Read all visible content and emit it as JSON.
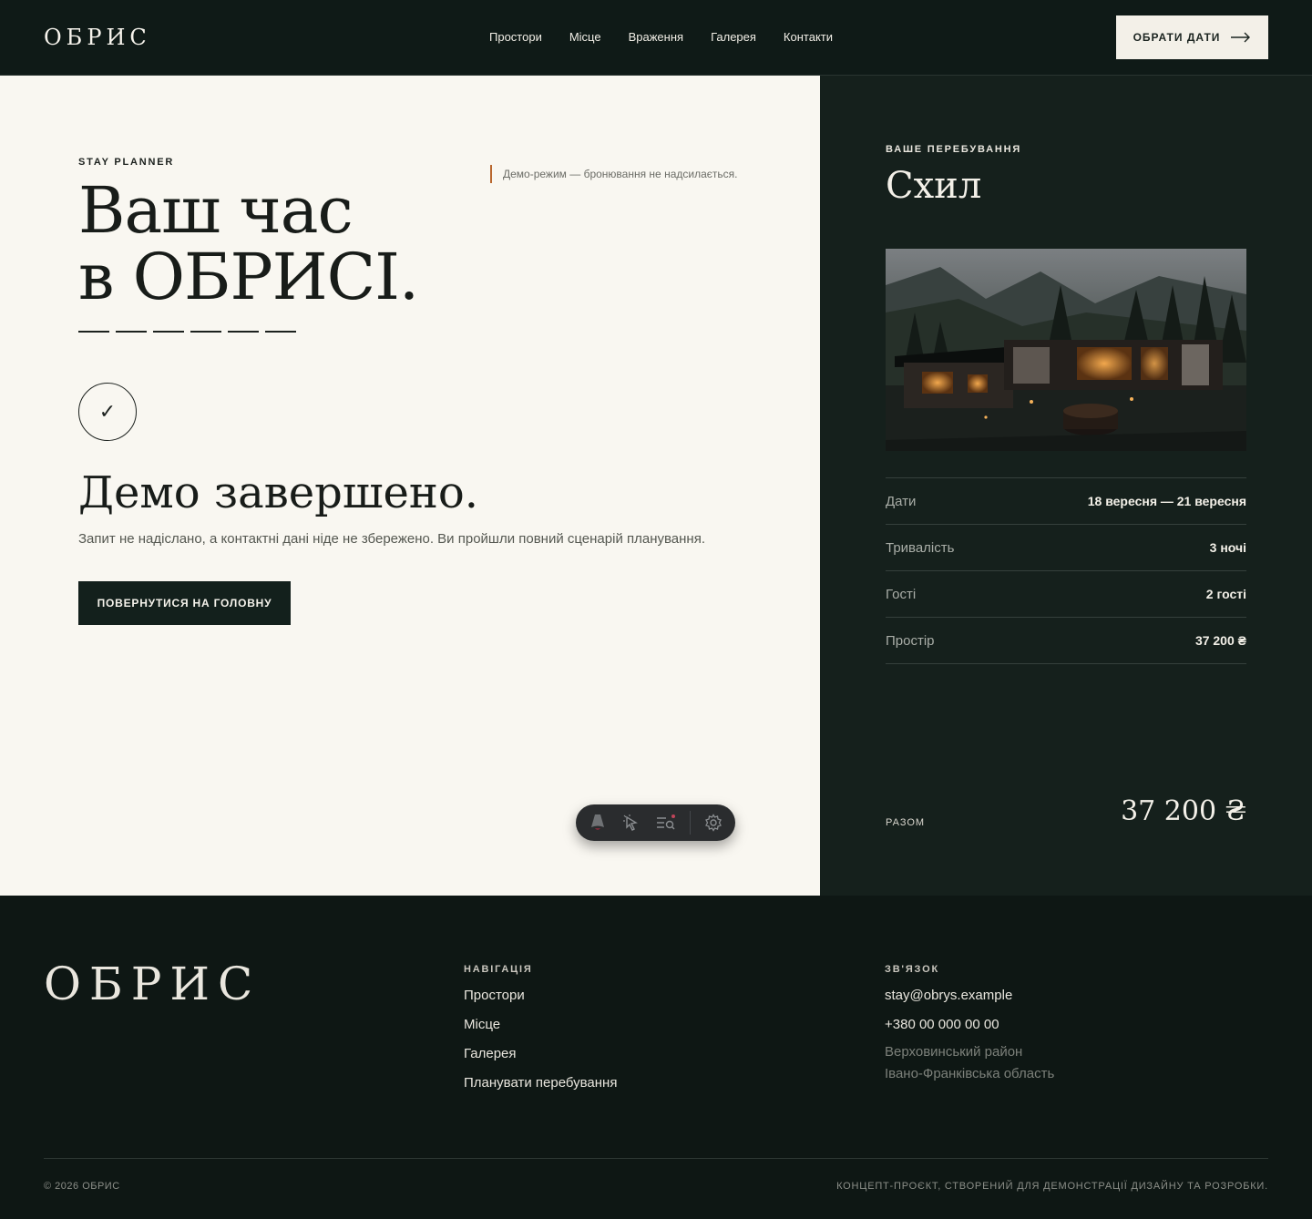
{
  "header": {
    "logo": "ОБРИС",
    "nav": [
      "Простори",
      "Місце",
      "Враження",
      "Галерея",
      "Контакти"
    ],
    "cta_label": "ОБРАТИ ДАТИ"
  },
  "planner": {
    "eyebrow": "STAY PLANNER",
    "demo_note": "Демо-режим — бронювання не надсилається.",
    "title_line1": "Ваш час",
    "title_line2": "в ОБРИСІ.",
    "step_count": 6,
    "check_symbol": "✓",
    "done_title": "Демо завершено.",
    "done_text": "Запит не надіслано, а контактні дані ніде не збережено. Ви пройшли повний сценарій планування.",
    "back_button": "ПОВЕРНУТИСЯ НА ГОЛОВНУ"
  },
  "toolbar": {
    "icons": [
      "astro-icon",
      "cursor-select-icon",
      "search-list-icon",
      "settings-gear-icon"
    ]
  },
  "summary": {
    "label": "ВАШЕ ПЕРЕБУВАННЯ",
    "name": "Схил",
    "rows": [
      {
        "key": "Дати",
        "value": "18 вересня — 21 вересня"
      },
      {
        "key": "Тривалість",
        "value": "3 ночі"
      },
      {
        "key": "Гості",
        "value": "2 гості"
      },
      {
        "key": "Простір",
        "value": "37 200 ₴"
      }
    ],
    "total_label": "РАЗОМ",
    "total_value": "37 200 ₴"
  },
  "footer": {
    "logo": "ОБРИС",
    "nav_title": "НАВІГАЦІЯ",
    "nav_links": [
      "Простори",
      "Місце",
      "Галерея",
      "Планувати перебування"
    ],
    "contact_title": "ЗВ'ЯЗОК",
    "email": "stay@obrys.example",
    "phone": "+380 00 000 00 00",
    "address_line1": "Верховинський район",
    "address_line2": "Івано-Франківська область",
    "copyright": "© 2026 ОБРИС",
    "concept": "КОНЦЕПТ-ПРОЄКТ, СТВОРЕНИЙ ДЛЯ ДЕМОНСТРАЦІЇ ДИЗАЙНУ ТА РОЗРОБКИ."
  },
  "colors": {
    "dark": "#0f1a17",
    "panel": "#15201c",
    "cream": "#f9f7f1",
    "accent": "#b9672e"
  }
}
